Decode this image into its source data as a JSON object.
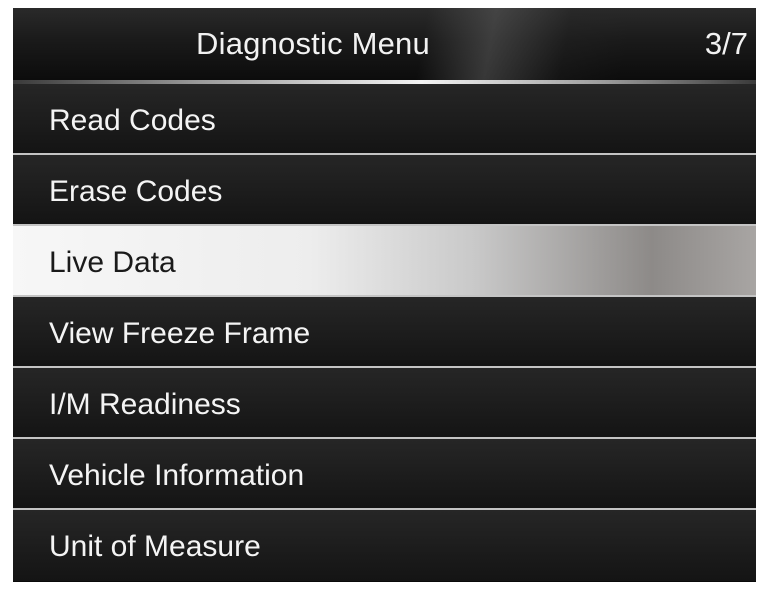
{
  "header": {
    "title": "Diagnostic Menu",
    "page_indicator": "3/7"
  },
  "menu": {
    "selected_index": 2,
    "items": [
      {
        "label": "Read Codes"
      },
      {
        "label": "Erase Codes"
      },
      {
        "label": "Live Data"
      },
      {
        "label": "View Freeze Frame"
      },
      {
        "label": "I/M Readiness"
      },
      {
        "label": "Vehicle Information"
      },
      {
        "label": "Unit of Measure"
      }
    ]
  },
  "colors": {
    "background": "#0a0a0a",
    "text": "#f4f4f4",
    "selected_text": "#1a1a1a",
    "selected_highlight": "#ededed",
    "divider": "#c4c4c4"
  }
}
